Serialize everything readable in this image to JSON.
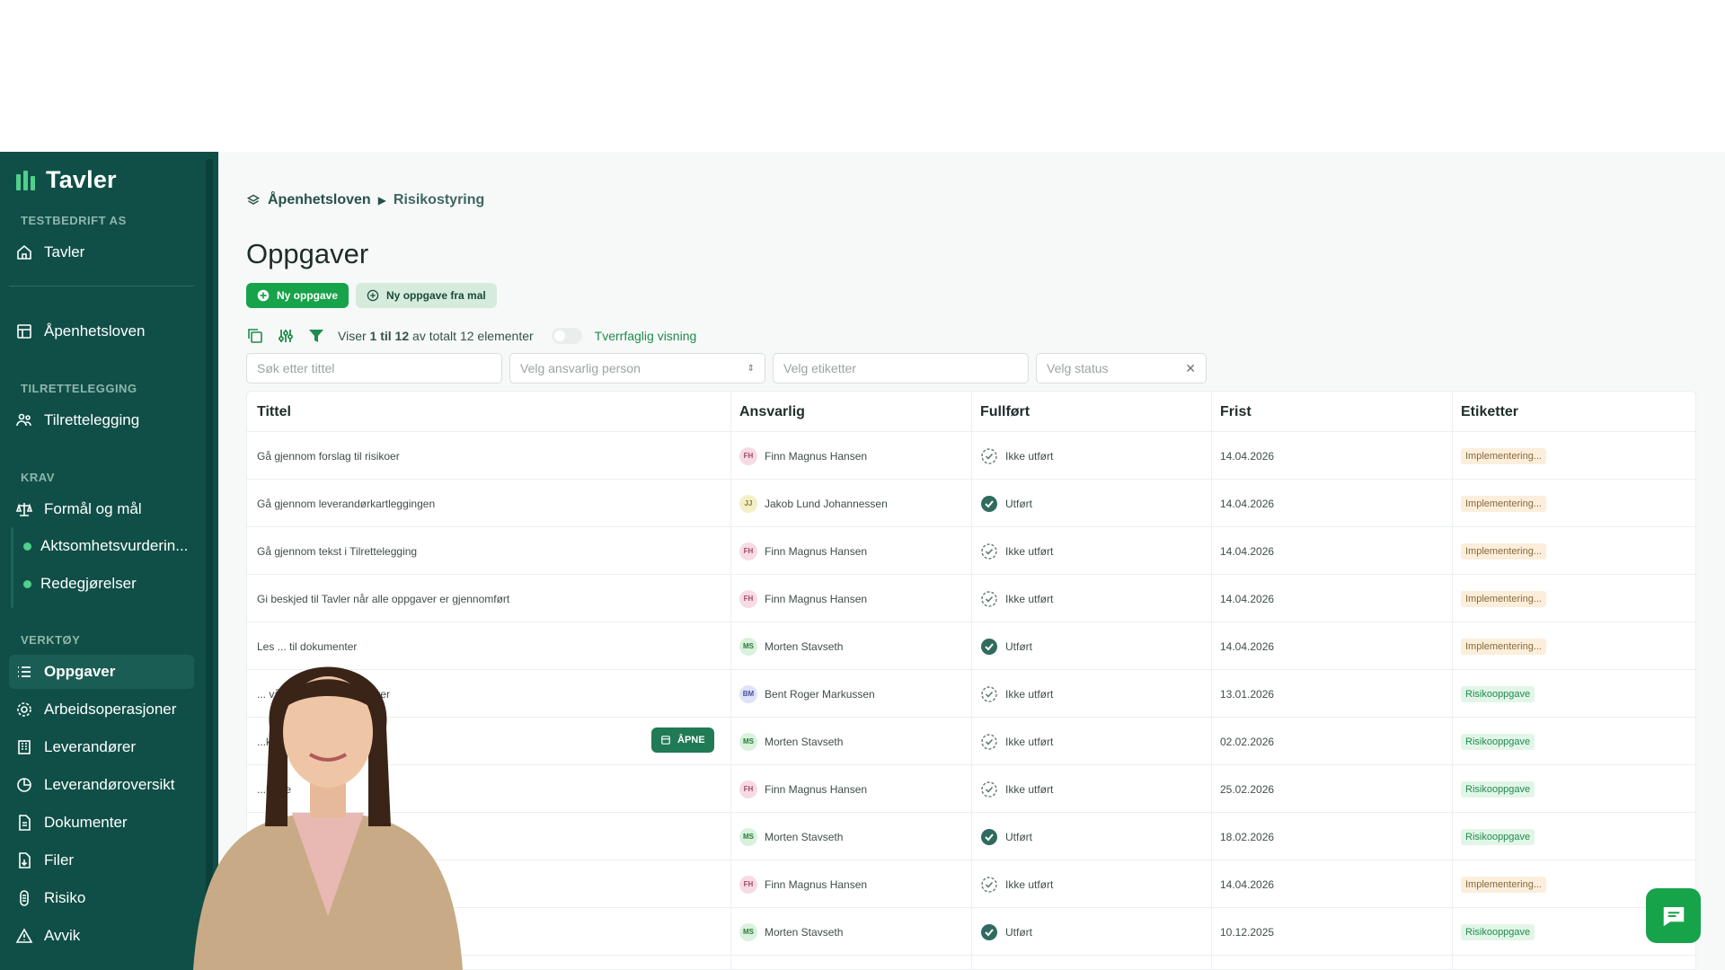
{
  "sidebar": {
    "brand": "Tavler",
    "company": "TESTBEDRIFT AS",
    "items": {
      "tavler": "Tavler",
      "apenhetsloven": "Åpenhetsloven",
      "tilrettelegging_section": "TILRETTELEGGING",
      "tilrettelegging": "Tilrettelegging",
      "krav_section": "KRAV",
      "formal": "Formål og mål",
      "aktsomhet": "Aktsomhetsvurderin...",
      "redegjorelser": "Redegjørelser",
      "verktoy_section": "VERKTØY",
      "oppgaver": "Oppgaver",
      "arbeidsoperasjoner": "Arbeidsoperasjoner",
      "leverandorer": "Leverandører",
      "leverandoroversikt": "Leverandøroversikt",
      "dokumenter": "Dokumenter",
      "filer": "Filer",
      "risiko": "Risiko",
      "avvik": "Avvik"
    }
  },
  "breadcrumb": {
    "first": "Åpenhetsloven",
    "second": "Risikostyring"
  },
  "page_title": "Oppgaver",
  "buttons": {
    "new_task": "Ny oppgave",
    "new_from_template": "Ny oppgave fra mal"
  },
  "toolbar": {
    "showing_prefix": "Viser",
    "showing_range": "1 til 12",
    "showing_suffix": "av totalt 12 elementer",
    "toggle_label": "Tverrfaglig visning"
  },
  "filters": {
    "search_placeholder": "Søk etter tittel",
    "person_placeholder": "Velg ansvarlig person",
    "tags_placeholder": "Velg etiketter",
    "status_placeholder": "Velg status"
  },
  "table": {
    "headers": {
      "title": "Tittel",
      "responsible": "Ansvarlig",
      "done": "Fullført",
      "deadline": "Frist",
      "tags": "Etiketter"
    },
    "open_button": "ÅPNE",
    "rows": [
      {
        "title": "Gå gjennom forslag til risikoer",
        "initials": "FH",
        "person": "Finn Magnus Hansen",
        "status": "Ikke utført",
        "date": "14.04.2026",
        "tag": "Implementering..."
      },
      {
        "title": "Gå gjennom leverandørkartleggingen",
        "initials": "JJ",
        "person": "Jakob Lund Johannessen",
        "status": "Utført",
        "date": "14.04.2026",
        "tag": "Implementering..."
      },
      {
        "title": "Gå gjennom tekst i Tilrettelegging",
        "initials": "FH",
        "person": "Finn Magnus Hansen",
        "status": "Ikke utført",
        "date": "14.04.2026",
        "tag": "Implementering..."
      },
      {
        "title": "Gi beskjed til Tavler når alle oppgaver er gjennomført",
        "initials": "FH",
        "person": "Finn Magnus Hansen",
        "status": "Ikke utført",
        "date": "14.04.2026",
        "tag": "Implementering..."
      },
      {
        "title": "Les ... til dokumenter",
        "initials": "MS",
        "person": "Morten Stavseth",
        "status": "Utført",
        "date": "14.04.2026",
        "tag": "Implementering..."
      },
      {
        "title": "... våre største leverandører",
        "initials": "BM",
        "person": "Bent Roger Markussen",
        "status": "Ikke utført",
        "date": "13.01.2026",
        "tag": "Risikooppgave"
      },
      {
        "title": "...krav",
        "initials": "MS",
        "person": "Morten Stavseth",
        "status": "Ikke utført",
        "date": "02.02.2026",
        "tag": "Risikooppgave"
      },
      {
        "title": "...kelse",
        "initials": "FH",
        "person": "Finn Magnus Hansen",
        "status": "Ikke utført",
        "date": "25.02.2026",
        "tag": "Risikooppgave"
      },
      {
        "title": "",
        "initials": "MS",
        "person": "Morten Stavseth",
        "status": "Utført",
        "date": "18.02.2026",
        "tag": "Risikooppgave"
      },
      {
        "title": "",
        "initials": "FH",
        "person": "Finn Magnus Hansen",
        "status": "Ikke utført",
        "date": "14.04.2026",
        "tag": "Implementering..."
      },
      {
        "title": "",
        "initials": "MS",
        "person": "Morten Stavseth",
        "status": "Utført",
        "date": "10.12.2025",
        "tag": "Risikooppgave"
      }
    ]
  },
  "colors": {
    "sidebar": "#0f4f47",
    "accent": "#16a34a",
    "impl_tag": "#fbeedb",
    "risk_tag": "#e2f6e8"
  },
  "icons": [
    "home-icon",
    "document-icon",
    "people-icon",
    "scale-icon",
    "list-icon",
    "gear-icon",
    "building-icon",
    "pie-icon",
    "file-icon",
    "shield-icon",
    "warning-icon",
    "chat-icon"
  ]
}
